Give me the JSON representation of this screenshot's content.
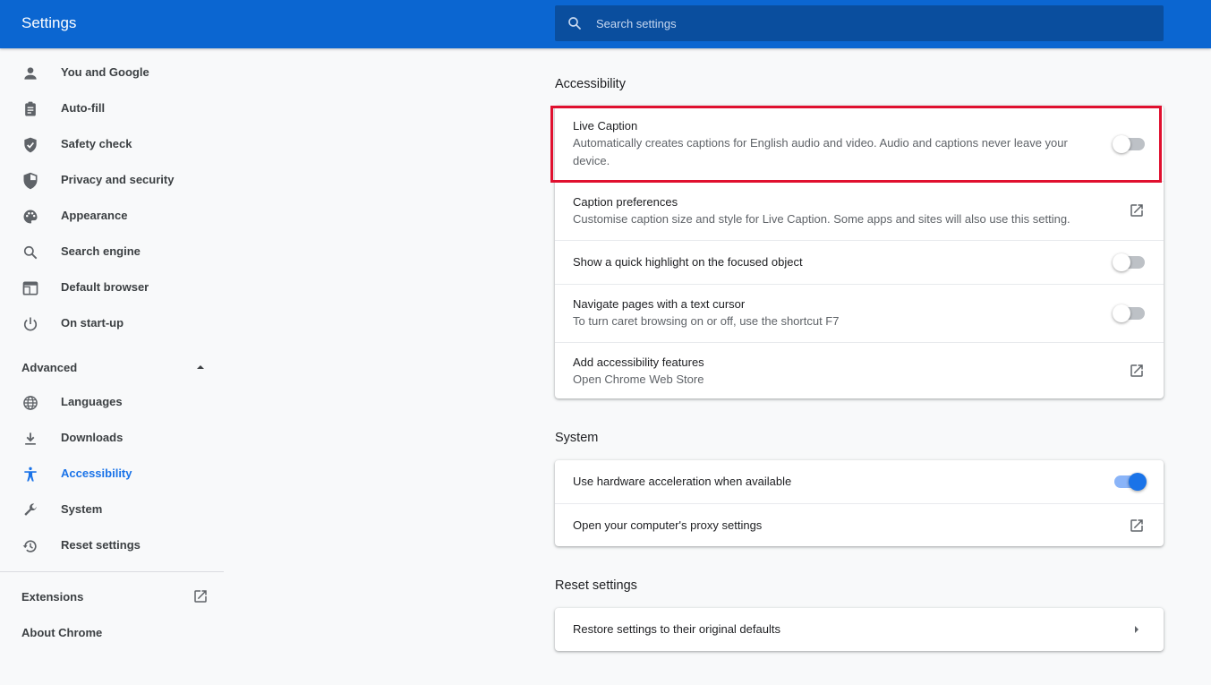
{
  "header": {
    "title": "Settings",
    "search_placeholder": "Search settings"
  },
  "sidebar": {
    "items": [
      {
        "label": "You and Google",
        "icon": "person-icon"
      },
      {
        "label": "Auto-fill",
        "icon": "clipboard-icon"
      },
      {
        "label": "Safety check",
        "icon": "shield-check-icon"
      },
      {
        "label": "Privacy and security",
        "icon": "shield-half-icon"
      },
      {
        "label": "Appearance",
        "icon": "palette-icon"
      },
      {
        "label": "Search engine",
        "icon": "search-icon"
      },
      {
        "label": "Default browser",
        "icon": "browser-window-icon"
      },
      {
        "label": "On start-up",
        "icon": "power-icon"
      }
    ],
    "advanced_label": "Advanced",
    "advanced_items": [
      {
        "label": "Languages",
        "icon": "globe-icon"
      },
      {
        "label": "Downloads",
        "icon": "download-icon"
      },
      {
        "label": "Accessibility",
        "icon": "accessibility-icon",
        "active": true
      },
      {
        "label": "System",
        "icon": "wrench-icon"
      },
      {
        "label": "Reset settings",
        "icon": "history-icon"
      }
    ],
    "extensions_label": "Extensions",
    "about_label": "About Chrome"
  },
  "main": {
    "accessibility": {
      "title": "Accessibility",
      "live_caption": {
        "title": "Live Caption",
        "description_line1": "Automatically creates captions for English audio and video. Audio and captions never leave your",
        "description_line2": "device.",
        "enabled": false
      },
      "caption_preferences": {
        "title": "Caption preferences",
        "description": "Customise caption size and style for Live Caption. Some apps and sites will also use this setting."
      },
      "quick_highlight": {
        "title": "Show a quick highlight on the focused object",
        "enabled": false
      },
      "text_cursor": {
        "title": "Navigate pages with a text cursor",
        "description": "To turn caret browsing on or off, use the shortcut F7",
        "enabled": false
      },
      "add_features": {
        "title": "Add accessibility features",
        "description": "Open Chrome Web Store"
      }
    },
    "system": {
      "title": "System",
      "hardware_acceleration": {
        "title": "Use hardware acceleration when available",
        "enabled": true
      },
      "proxy": {
        "title": "Open your computer's proxy settings"
      }
    },
    "reset": {
      "title": "Reset settings",
      "restore": {
        "title": "Restore settings to their original defaults"
      }
    }
  },
  "colors": {
    "header_bg": "#0b66d1",
    "accent": "#1a73e8",
    "highlight_box": "#e0102f"
  }
}
